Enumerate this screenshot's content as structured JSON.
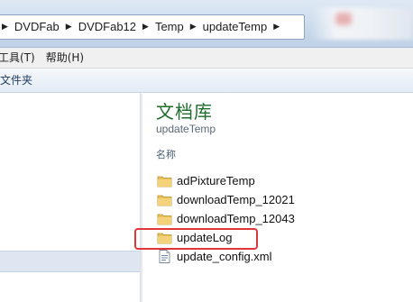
{
  "address": {
    "path": [
      "DVDFab",
      "DVDFab12",
      "Temp",
      "updateTemp"
    ]
  },
  "menu": {
    "items": [
      "工具(T)",
      "帮助(H)"
    ]
  },
  "toolbar": {
    "new_folder_label": "文件夹"
  },
  "library": {
    "title": "文档库",
    "subtitle": "updateTemp",
    "column_header": "名称"
  },
  "files": [
    {
      "name": "adPixtureTemp",
      "type": "folder",
      "icon": "folder-icon"
    },
    {
      "name": "downloadTemp_12021",
      "type": "folder",
      "icon": "folder-icon"
    },
    {
      "name": "downloadTemp_12043",
      "type": "folder",
      "icon": "folder-icon"
    },
    {
      "name": "updateLog",
      "type": "folder",
      "icon": "folder-icon",
      "highlighted": true
    },
    {
      "name": "update_config.xml",
      "type": "file",
      "icon": "xml-file-icon"
    }
  ],
  "colors": {
    "library_title": "#1e6e2e",
    "highlight": "#e0363a",
    "folder": "#e8c15a"
  }
}
